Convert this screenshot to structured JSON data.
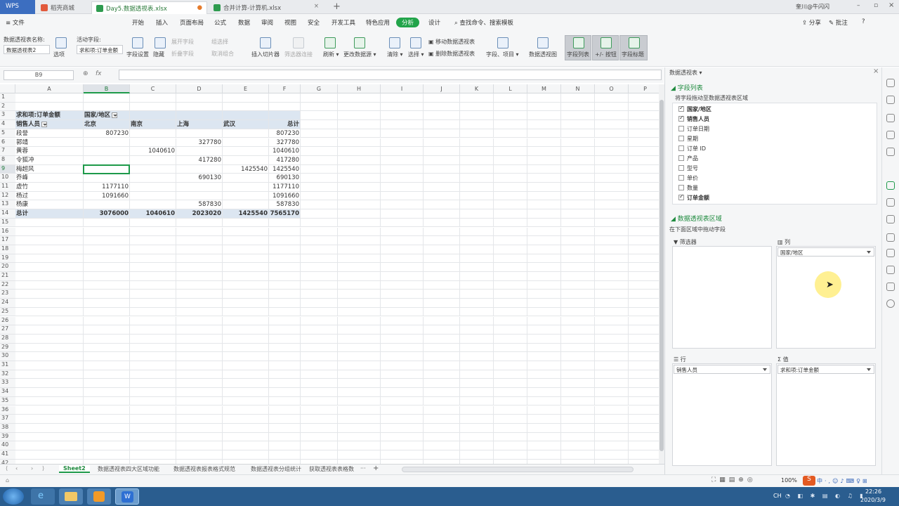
{
  "app": {
    "wps_label": "WPS"
  },
  "tabs": [
    {
      "label": "稻壳商城"
    },
    {
      "label": "Day5.数据透视表.xlsx"
    },
    {
      "label": "合并计算-计算机.xlsx"
    }
  ],
  "top_right": {
    "user": "奎川@牛闪闪"
  },
  "menu": {
    "file": "文件",
    "items": [
      "开始",
      "插入",
      "页面布局",
      "公式",
      "数据",
      "审阅",
      "视图",
      "安全",
      "开发工具",
      "特色应用"
    ],
    "active": "分析",
    "design": "设计",
    "search": "查找命令、搜索模板",
    "share": "分享",
    "comment": "批注",
    "help": "?"
  },
  "ribbon": {
    "pivot_name_label": "数据透视表名称:",
    "pivot_name_value": "数据透视表2",
    "options": "选项",
    "active_field_label": "活动字段:",
    "active_field_value": "求和项:订单金额",
    "field_settings": "字段设置",
    "hide": "隐藏",
    "expand_field": "展开字段",
    "collapse_field": "折叠字段",
    "group_selection": "组选择",
    "ungroup": "取消组合",
    "insert_slicer": "插入切片器",
    "filter_connections": "筛选器连接",
    "refresh": "刷新",
    "change_source": "更改数据源",
    "clear": "清除",
    "select": "选择",
    "move_pivot": "移动数据透视表",
    "delete_pivot": "删除数据透视表",
    "fields_items": "字段、项目",
    "pivot_chart": "数据透视图",
    "field_list": "字段列表",
    "buttons": "+/- 按钮",
    "field_headers": "字段标题"
  },
  "formula_bar": {
    "name_box": "B9",
    "fx": "fx",
    "content": ""
  },
  "columns": [
    "A",
    "B",
    "C",
    "D",
    "E",
    "F",
    "G",
    "H",
    "I",
    "J",
    "K",
    "L",
    "M",
    "N",
    "O",
    "P"
  ],
  "rows": [
    "1",
    "2",
    "3",
    "4",
    "5",
    "6",
    "7",
    "8",
    "9",
    "10",
    "11",
    "12",
    "13",
    "14",
    "15",
    "16",
    "17",
    "18",
    "19",
    "20",
    "21",
    "22",
    "23",
    "24",
    "25",
    "26",
    "27",
    "28",
    "29",
    "30",
    "31",
    "32",
    "33",
    "34",
    "35",
    "36",
    "37",
    "38",
    "39",
    "40",
    "41",
    "42"
  ],
  "pivot": {
    "value_label": "求和项:订单金额",
    "col_field": "国家/地区",
    "row_field": "销售人员",
    "col_headers": [
      "北京",
      "南京",
      "上海",
      "武汉",
      "总计"
    ],
    "rows": [
      {
        "name": "段誉",
        "cells": [
          "807230",
          "",
          "",
          "",
          "807230"
        ]
      },
      {
        "name": "郭靖",
        "cells": [
          "",
          "",
          "327780",
          "",
          "327780"
        ]
      },
      {
        "name": "黄蓉",
        "cells": [
          "",
          "1040610",
          "",
          "",
          "1040610"
        ]
      },
      {
        "name": "令狐冲",
        "cells": [
          "",
          "",
          "417280",
          "",
          "417280"
        ]
      },
      {
        "name": "梅超风",
        "cells": [
          "",
          "",
          "",
          "1425540",
          "1425540"
        ]
      },
      {
        "name": "乔峰",
        "cells": [
          "",
          "",
          "690130",
          "",
          "690130"
        ]
      },
      {
        "name": "虚竹",
        "cells": [
          "1177110",
          "",
          "",
          "",
          "1177110"
        ]
      },
      {
        "name": "杨过",
        "cells": [
          "1091660",
          "",
          "",
          "",
          "1091660"
        ]
      },
      {
        "name": "杨康",
        "cells": [
          "",
          "",
          "587830",
          "",
          "587830"
        ]
      }
    ],
    "total_label": "总计",
    "totals": [
      "3076000",
      "1040610",
      "2023020",
      "1425540",
      "7565170"
    ]
  },
  "sheet_tabs": {
    "active": "Sheet2",
    "others": [
      "数据透视表四大区域功能",
      "数据透视表报表格式规范",
      "数据透视表分组统计",
      "获取透视表表格数"
    ],
    "more": "···",
    "add": "+"
  },
  "panel": {
    "title": "数据透视表",
    "field_list_title": "字段列表",
    "drag_hint": "将字段拖动至数据透视表区域",
    "fields": [
      {
        "name": "国家/地区",
        "checked": true
      },
      {
        "name": "销售人员",
        "checked": true
      },
      {
        "name": "订单日期",
        "checked": false
      },
      {
        "name": "星期",
        "checked": false
      },
      {
        "name": "订单 ID",
        "checked": false
      },
      {
        "name": "产品",
        "checked": false
      },
      {
        "name": "型号",
        "checked": false
      },
      {
        "name": "单价",
        "checked": false
      },
      {
        "name": "数量",
        "checked": false
      },
      {
        "name": "订单金额",
        "checked": true
      }
    ],
    "areas_title": "数据透视表区域",
    "areas_hint": "在下面区域中拖动字段",
    "filter_label": "筛选器",
    "column_label": "列",
    "row_label": "行",
    "value_label": "值",
    "column_item": "国家/地区",
    "row_item": "销售人员",
    "value_item": "求和项:订单金额"
  },
  "status": {
    "zoom": "100%"
  },
  "taskbar": {
    "lang": "CH",
    "time": "22:26",
    "date": "2020/3/9"
  }
}
